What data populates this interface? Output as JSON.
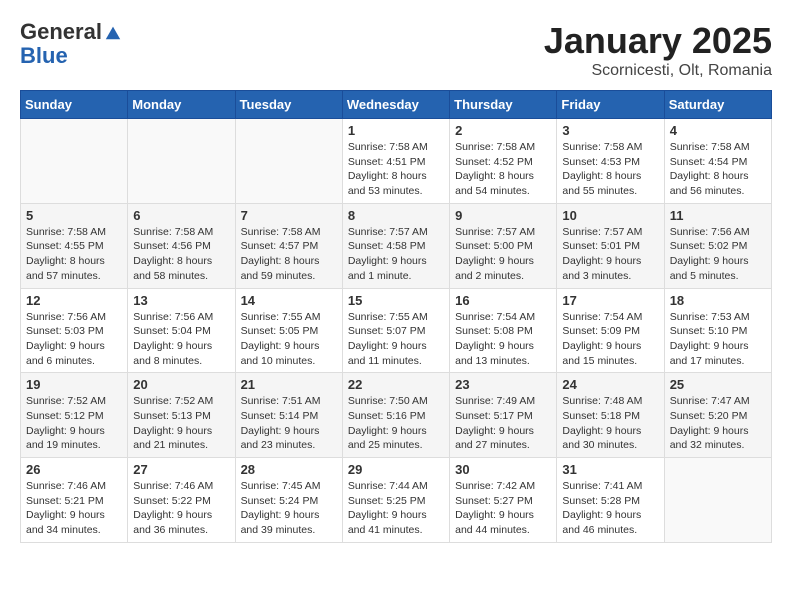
{
  "header": {
    "logo_general": "General",
    "logo_blue": "Blue",
    "month_title": "January 2025",
    "location": "Scornicesti, Olt, Romania"
  },
  "weekdays": [
    "Sunday",
    "Monday",
    "Tuesday",
    "Wednesday",
    "Thursday",
    "Friday",
    "Saturday"
  ],
  "weeks": [
    [
      {
        "day": "",
        "info": ""
      },
      {
        "day": "",
        "info": ""
      },
      {
        "day": "",
        "info": ""
      },
      {
        "day": "1",
        "info": "Sunrise: 7:58 AM\nSunset: 4:51 PM\nDaylight: 8 hours\nand 53 minutes."
      },
      {
        "day": "2",
        "info": "Sunrise: 7:58 AM\nSunset: 4:52 PM\nDaylight: 8 hours\nand 54 minutes."
      },
      {
        "day": "3",
        "info": "Sunrise: 7:58 AM\nSunset: 4:53 PM\nDaylight: 8 hours\nand 55 minutes."
      },
      {
        "day": "4",
        "info": "Sunrise: 7:58 AM\nSunset: 4:54 PM\nDaylight: 8 hours\nand 56 minutes."
      }
    ],
    [
      {
        "day": "5",
        "info": "Sunrise: 7:58 AM\nSunset: 4:55 PM\nDaylight: 8 hours\nand 57 minutes."
      },
      {
        "day": "6",
        "info": "Sunrise: 7:58 AM\nSunset: 4:56 PM\nDaylight: 8 hours\nand 58 minutes."
      },
      {
        "day": "7",
        "info": "Sunrise: 7:58 AM\nSunset: 4:57 PM\nDaylight: 8 hours\nand 59 minutes."
      },
      {
        "day": "8",
        "info": "Sunrise: 7:57 AM\nSunset: 4:58 PM\nDaylight: 9 hours\nand 1 minute."
      },
      {
        "day": "9",
        "info": "Sunrise: 7:57 AM\nSunset: 5:00 PM\nDaylight: 9 hours\nand 2 minutes."
      },
      {
        "day": "10",
        "info": "Sunrise: 7:57 AM\nSunset: 5:01 PM\nDaylight: 9 hours\nand 3 minutes."
      },
      {
        "day": "11",
        "info": "Sunrise: 7:56 AM\nSunset: 5:02 PM\nDaylight: 9 hours\nand 5 minutes."
      }
    ],
    [
      {
        "day": "12",
        "info": "Sunrise: 7:56 AM\nSunset: 5:03 PM\nDaylight: 9 hours\nand 6 minutes."
      },
      {
        "day": "13",
        "info": "Sunrise: 7:56 AM\nSunset: 5:04 PM\nDaylight: 9 hours\nand 8 minutes."
      },
      {
        "day": "14",
        "info": "Sunrise: 7:55 AM\nSunset: 5:05 PM\nDaylight: 9 hours\nand 10 minutes."
      },
      {
        "day": "15",
        "info": "Sunrise: 7:55 AM\nSunset: 5:07 PM\nDaylight: 9 hours\nand 11 minutes."
      },
      {
        "day": "16",
        "info": "Sunrise: 7:54 AM\nSunset: 5:08 PM\nDaylight: 9 hours\nand 13 minutes."
      },
      {
        "day": "17",
        "info": "Sunrise: 7:54 AM\nSunset: 5:09 PM\nDaylight: 9 hours\nand 15 minutes."
      },
      {
        "day": "18",
        "info": "Sunrise: 7:53 AM\nSunset: 5:10 PM\nDaylight: 9 hours\nand 17 minutes."
      }
    ],
    [
      {
        "day": "19",
        "info": "Sunrise: 7:52 AM\nSunset: 5:12 PM\nDaylight: 9 hours\nand 19 minutes."
      },
      {
        "day": "20",
        "info": "Sunrise: 7:52 AM\nSunset: 5:13 PM\nDaylight: 9 hours\nand 21 minutes."
      },
      {
        "day": "21",
        "info": "Sunrise: 7:51 AM\nSunset: 5:14 PM\nDaylight: 9 hours\nand 23 minutes."
      },
      {
        "day": "22",
        "info": "Sunrise: 7:50 AM\nSunset: 5:16 PM\nDaylight: 9 hours\nand 25 minutes."
      },
      {
        "day": "23",
        "info": "Sunrise: 7:49 AM\nSunset: 5:17 PM\nDaylight: 9 hours\nand 27 minutes."
      },
      {
        "day": "24",
        "info": "Sunrise: 7:48 AM\nSunset: 5:18 PM\nDaylight: 9 hours\nand 30 minutes."
      },
      {
        "day": "25",
        "info": "Sunrise: 7:47 AM\nSunset: 5:20 PM\nDaylight: 9 hours\nand 32 minutes."
      }
    ],
    [
      {
        "day": "26",
        "info": "Sunrise: 7:46 AM\nSunset: 5:21 PM\nDaylight: 9 hours\nand 34 minutes."
      },
      {
        "day": "27",
        "info": "Sunrise: 7:46 AM\nSunset: 5:22 PM\nDaylight: 9 hours\nand 36 minutes."
      },
      {
        "day": "28",
        "info": "Sunrise: 7:45 AM\nSunset: 5:24 PM\nDaylight: 9 hours\nand 39 minutes."
      },
      {
        "day": "29",
        "info": "Sunrise: 7:44 AM\nSunset: 5:25 PM\nDaylight: 9 hours\nand 41 minutes."
      },
      {
        "day": "30",
        "info": "Sunrise: 7:42 AM\nSunset: 5:27 PM\nDaylight: 9 hours\nand 44 minutes."
      },
      {
        "day": "31",
        "info": "Sunrise: 7:41 AM\nSunset: 5:28 PM\nDaylight: 9 hours\nand 46 minutes."
      },
      {
        "day": "",
        "info": ""
      }
    ]
  ]
}
